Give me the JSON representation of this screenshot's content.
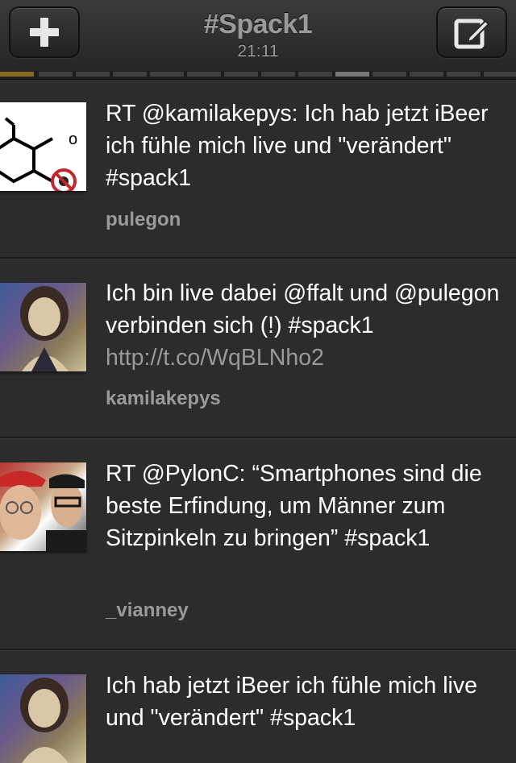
{
  "header": {
    "title": "#Spack1",
    "time": "21:11",
    "left_button_icon": "plus-icon",
    "right_button_icon": "compose-icon"
  },
  "tweets": [
    {
      "text": "RT @kamilakepys: Ich hab jetzt iBeer ich fühle mich live und \"verändert\" #spack1",
      "link": "",
      "user": "pulegon",
      "avatar": "molecule-avatar"
    },
    {
      "text": "Ich bin live dabei @ffalt und @pulegon verbinden sich (!) #spack1",
      "link": "http://t.co/WqBLNho2",
      "user": "kamilakepys",
      "avatar": "woman-photo-avatar"
    },
    {
      "text": "RT @PylonC: “Smartphones sind die beste Erfindung, um Männer zum Sitzpinkeln zu bringen” #spack1",
      "link": "",
      "user": "_vianney",
      "avatar": "two-men-photo-avatar"
    },
    {
      "text": "Ich hab jetzt iBeer ich fühle mich live und \"verändert\" #spack1",
      "link": "",
      "user": "",
      "avatar": "woman-photo-avatar"
    }
  ]
}
